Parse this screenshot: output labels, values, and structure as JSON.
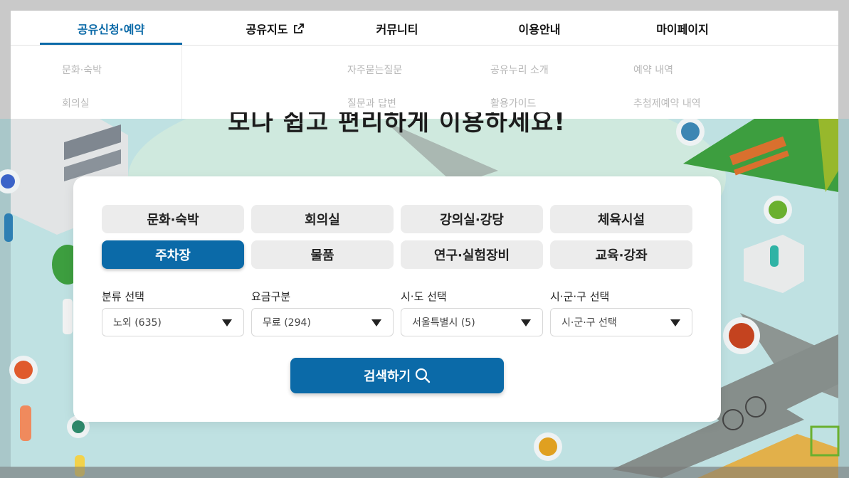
{
  "nav": {
    "items": [
      {
        "label": "공유신청·예약",
        "active": true
      },
      {
        "label": "공유지도",
        "external": true
      },
      {
        "label": "커뮤니티"
      },
      {
        "label": "이용안내"
      },
      {
        "label": "마이페이지"
      }
    ],
    "submenu": {
      "col1": [
        "문화·숙박",
        "회의실"
      ],
      "col3": [
        "자주묻는질문",
        "질문과 답변"
      ],
      "col4": [
        "공유누리 소개",
        "활용가이드"
      ],
      "col5": [
        "예약 내역",
        "추첨제예약 내역"
      ]
    }
  },
  "headline": "모나 쉽고 편리하게 이용하세요!",
  "categories": [
    {
      "label": "문화·숙박",
      "active": false
    },
    {
      "label": "회의실",
      "active": false
    },
    {
      "label": "강의실·강당",
      "active": false
    },
    {
      "label": "체육시설",
      "active": false
    },
    {
      "label": "주차장",
      "active": true
    },
    {
      "label": "물품",
      "active": false
    },
    {
      "label": "연구·실험장비",
      "active": false
    },
    {
      "label": "교육·강좌",
      "active": false
    }
  ],
  "filters": [
    {
      "label": "분류 선택",
      "value": "노외 (635)"
    },
    {
      "label": "요금구분",
      "value": "무료 (294)"
    },
    {
      "label": "시·도 선택",
      "value": "서울특별시 (5)"
    },
    {
      "label": "시·군·구 선택",
      "value": "시·군·구 선택"
    }
  ],
  "search_button": "검색하기",
  "colors": {
    "primary": "#0b6aa8",
    "chip": "#ececec"
  },
  "icons": {
    "external": "external-link-icon",
    "search": "search-icon",
    "caret": "caret-down-icon"
  }
}
